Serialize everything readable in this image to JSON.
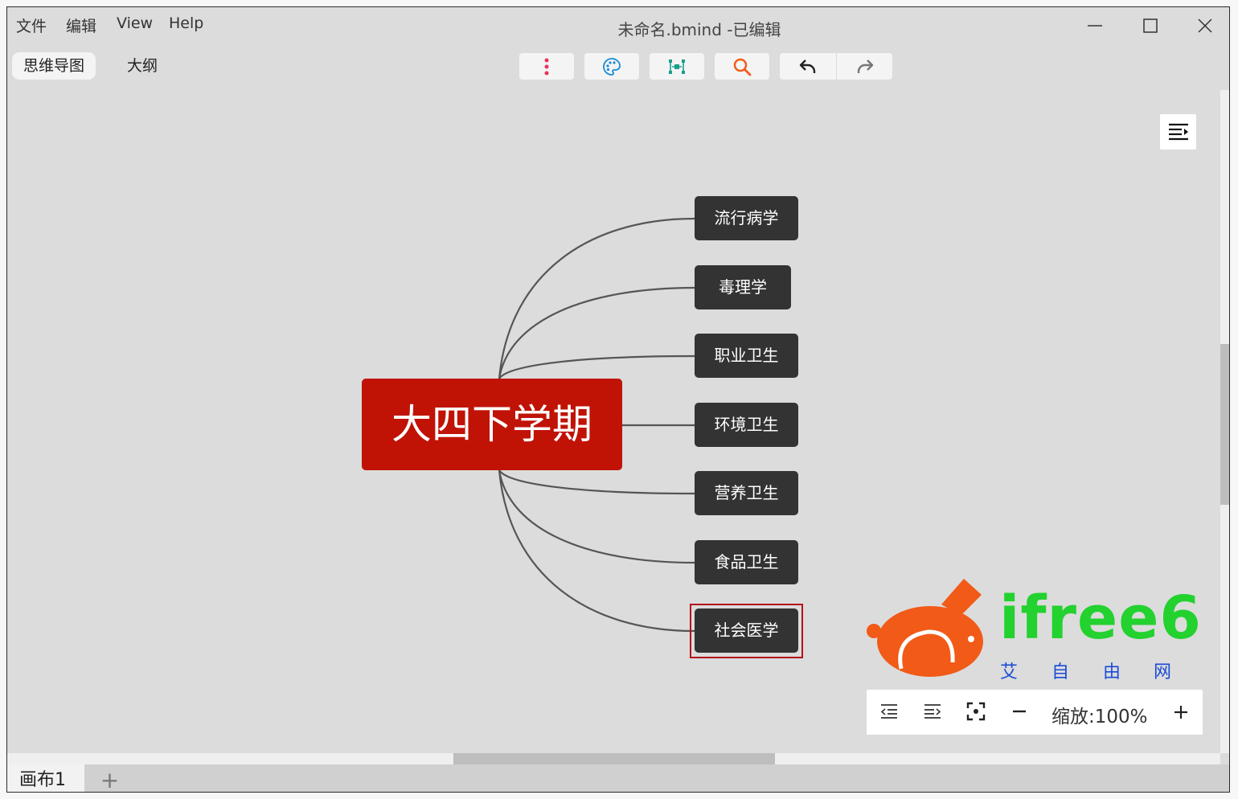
{
  "menu": {
    "file": "文件",
    "edit": "编辑",
    "view": "View",
    "help": "Help"
  },
  "window": {
    "title": "未命名.bmind -已编辑"
  },
  "view_tabs": {
    "mindmap": "思维导图",
    "outline": "大纲"
  },
  "toolbar": {
    "icons": [
      "more-vertical-icon",
      "palette-icon",
      "structure-icon",
      "search-icon",
      "undo-icon",
      "redo-icon"
    ],
    "accent_colors": {
      "more": "#e8335a",
      "palette": "#1a8bd6",
      "structure": "#1a9e8e",
      "search": "#f25c19"
    }
  },
  "mindmap": {
    "root": "大四下学期",
    "root_color": "#c01306",
    "topic_color": "#333333",
    "topics": [
      "流行病学",
      "毒理学",
      "职业卫生",
      "环境卫生",
      "营养卫生",
      "食品卫生",
      "社会医学"
    ],
    "selected_topic": "社会医学"
  },
  "watermark": {
    "brand": "ifree6",
    "chars": [
      "艾",
      "自",
      "由",
      "网"
    ]
  },
  "zoom": {
    "label": "缩放:100%",
    "level_percent": 100
  },
  "sheets": {
    "tabs": [
      "画布1"
    ],
    "add_label": "+"
  }
}
